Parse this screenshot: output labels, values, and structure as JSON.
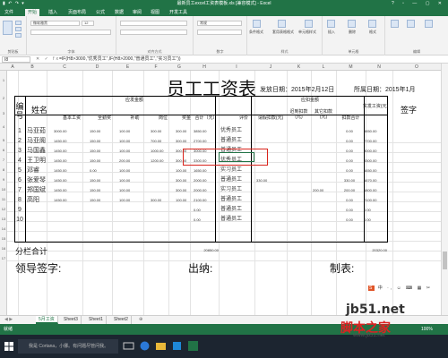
{
  "window": {
    "title": "最新员工excel工资表模板.xls [兼容模式] - Excel",
    "controls": "? ▫ — ▢ ✕",
    "qat": "▮ ↶ ↷ ▾"
  },
  "ribbon_tabs": [
    "文件",
    "开始",
    "插入",
    "页面布局",
    "公式",
    "数据",
    "审阅",
    "视图",
    "开发工具"
  ],
  "ribbon": {
    "font_name": "微软雅黑",
    "font_size": "12",
    "number_format": "常规",
    "groups": [
      "剪贴板",
      "字体",
      "对齐方式",
      "数字",
      "样式",
      "单元格",
      "编辑"
    ],
    "style_buttons": [
      "条件格式",
      "套用表格格式",
      "单元格样式"
    ],
    "cell_buttons": [
      "插入",
      "删除",
      "格式"
    ]
  },
  "formula_bar": {
    "cell_ref": "I8",
    "fx": "✕ ✓ fx",
    "formula": "=IF(H8>3000,\"优秀员工\",IF(H8>2000,\"普通员工\",\"实习员工\"))"
  },
  "columns": [
    "A",
    "B",
    "C",
    "D",
    "E",
    "F",
    "G",
    "H",
    "I",
    "J",
    "K",
    "L",
    "M",
    "N",
    "O"
  ],
  "rows": [
    "1",
    "2",
    "3",
    "4",
    "5",
    "6",
    "7",
    "8",
    "9",
    "10",
    "11",
    "12",
    "13",
    "14",
    "15",
    "16",
    "17"
  ],
  "sheet": {
    "title": "员工工资表",
    "release_date_label": "发放日期：2015年2月12日",
    "period_label": "所属日期：2015年1月",
    "h_num": "编号",
    "h_name": "姓名",
    "h_payable": "应发金额",
    "h_base": "基本工资",
    "h_attend": "全勤奖",
    "h_subsidy": "补助",
    "h_post": "岗位",
    "h_bonus": "奖金",
    "h_total": "合计（元）",
    "h_eval": "评价",
    "h_deduct": "应扣金额",
    "h_leave": "请假扣款(元)",
    "h_late": "迟到扣款(元)",
    "h_other": "其它扣款(元)",
    "h_deduct_total": "扣款合计",
    "h_actual": "实发工资(元)",
    "h_sign": "签字",
    "employees": [
      {
        "no": "1",
        "name": "马亚茹",
        "base": "3000.00",
        "attend": "150.00",
        "subsidy": "100.00",
        "post": "300.00",
        "bonus": "300.00",
        "total": "3850.00",
        "eval": "优秀员工",
        "leave": "",
        "late": "",
        "other": "",
        "dtotal": "0.00",
        "actual": "3850.00"
      },
      {
        "no": "2",
        "name": "马亚阁",
        "base": "1450.00",
        "attend": "150.00",
        "subsidy": "100.00",
        "post": "700.00",
        "bonus": "300.00",
        "total": "2700.00",
        "eval": "普通员工",
        "leave": "",
        "late": "",
        "other": "",
        "dtotal": "0.00",
        "actual": "2700.00"
      },
      {
        "no": "3",
        "name": "马国鑫",
        "base": "1450.00",
        "attend": "150.00",
        "subsidy": "100.00",
        "post": "1000.00",
        "bonus": "300.00",
        "total": "3000.00",
        "eval": "普通员工",
        "leave": "",
        "late": "",
        "other": "",
        "dtotal": "0.00",
        "actual": "3000.00"
      },
      {
        "no": "4",
        "name": "王卫明",
        "base": "1450.00",
        "attend": "150.00",
        "subsidy": "200.00",
        "post": "1200.00",
        "bonus": "300.00",
        "total": "3300.00",
        "eval": "优秀员工",
        "leave": "",
        "late": "",
        "other": "",
        "dtotal": "0.00",
        "actual": "3300.00"
      },
      {
        "no": "5",
        "name": "邓睿",
        "base": "1450.00",
        "attend": "0.00",
        "subsidy": "100.00",
        "post": "",
        "bonus": "100.00",
        "total": "1650.00",
        "eval": "实习员工",
        "leave": "",
        "late": "",
        "other": "",
        "dtotal": "0.00",
        "actual": "1650.00"
      },
      {
        "no": "6",
        "name": "张爱琴",
        "base": "1450.00",
        "attend": "150.00",
        "subsidy": "100.00",
        "post": "",
        "bonus": "300.00",
        "total": "2000.00",
        "eval": "普通员工",
        "leave": "330.00",
        "late": "",
        "other": "",
        "dtotal": "330.00",
        "actual": "1670.00"
      },
      {
        "no": "7",
        "name": "郑国斌",
        "base": "1450.00",
        "attend": "150.00",
        "subsidy": "100.00",
        "post": "",
        "bonus": "300.00",
        "total": "2000.00",
        "eval": "实习员工",
        "leave": "",
        "late": "",
        "other": "200.00",
        "dtotal": "200.00",
        "actual": "1800.00"
      },
      {
        "no": "8",
        "name": "高阳",
        "base": "1450.00",
        "attend": "150.00",
        "subsidy": "100.00",
        "post": "300.00",
        "bonus": "100.00",
        "total": "2100.00",
        "eval": "普通员工",
        "leave": "",
        "late": "",
        "other": "",
        "dtotal": "0.00",
        "actual": "2100.00"
      }
    ],
    "empty_rows": [
      {
        "no": "9",
        "total": "0.00",
        "eval": "普通员工",
        "dtotal": "0.00",
        "actual": "0.00"
      },
      {
        "no": "10",
        "total": "0.00",
        "eval": "普通员工",
        "dtotal": "0.00",
        "actual": "0.00"
      }
    ],
    "sum_label": "分栏合计",
    "sum_total": "20850.00",
    "sum_actual": "20320.00",
    "sign_leader": "领导签字:",
    "sign_cashier": "出纳:",
    "sign_maker": "制表:"
  },
  "sheet_tabs": [
    "5月工资",
    "Sheet3",
    "Sheet1",
    "Sheet2"
  ],
  "add_sheet": "⊕",
  "status": {
    "ready": "就绪",
    "zoom": "100%"
  },
  "mini_toolbar": {
    "s": "S",
    "rest": "中 ·, ☺ ⌨ ▦ ✂"
  },
  "taskbar": {
    "search": "我是 Cortana，小娜。有问题尽管问我。"
  },
  "watermark": {
    "site": "jb51.net",
    "brand": "脚本之家",
    "url": "www.jb51.net"
  }
}
